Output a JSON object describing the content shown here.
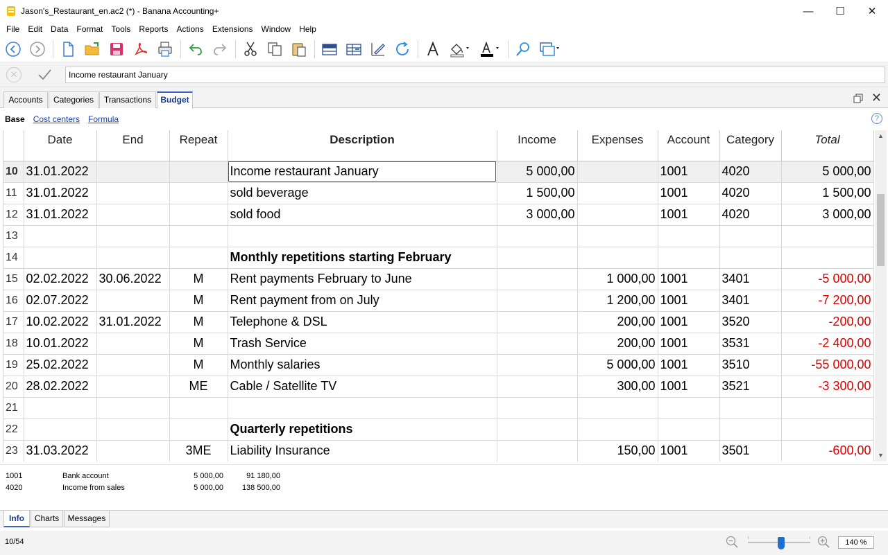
{
  "window": {
    "title": "Jason's_Restaurant_en.ac2 (*) - Banana Accounting+",
    "minimize": "—",
    "maximize": "☐",
    "close": "✕"
  },
  "menu": [
    "File",
    "Edit",
    "Data",
    "Format",
    "Tools",
    "Reports",
    "Actions",
    "Extensions",
    "Window",
    "Help"
  ],
  "toolbar_icons": [
    "back-icon",
    "forward-icon",
    "new-file-icon",
    "open-folder-icon",
    "save-icon",
    "pdf-icon",
    "print-icon",
    "undo-icon",
    "redo-icon",
    "cut-icon",
    "copy-icon",
    "paste-icon",
    "insert-rows-icon",
    "duplicate-row-icon",
    "edit-row-icon",
    "recalculate-icon",
    "font-icon",
    "fill-color-icon",
    "text-color-icon",
    "search-icon",
    "view-icon"
  ],
  "editline": {
    "value": "Income restaurant January"
  },
  "tabs": [
    "Accounts",
    "Categories",
    "Transactions",
    "Budget"
  ],
  "active_tab": "Budget",
  "views": {
    "base": "Base",
    "links": [
      "Cost centers",
      "Formula"
    ],
    "help": "?"
  },
  "table": {
    "columns": [
      "",
      "Date",
      "End",
      "Repeat",
      "Description",
      "Income",
      "Expenses",
      "Account",
      "Category",
      "Total"
    ],
    "rows": [
      {
        "n": "10",
        "date": "31.01.2022",
        "end": "",
        "repeat": "",
        "desc": "Income restaurant January",
        "income": "5 000,00",
        "expenses": "",
        "account": "1001",
        "category": "4020",
        "total": "5 000,00",
        "neg": false,
        "current": true
      },
      {
        "n": "11",
        "date": "31.01.2022",
        "end": "",
        "repeat": "",
        "desc": "sold beverage",
        "income": "1 500,00",
        "expenses": "",
        "account": "1001",
        "category": "4020",
        "total": "1 500,00",
        "neg": false
      },
      {
        "n": "12",
        "date": "31.01.2022",
        "end": "",
        "repeat": "",
        "desc": "sold food",
        "income": "3 000,00",
        "expenses": "",
        "account": "1001",
        "category": "4020",
        "total": "3 000,00",
        "neg": false
      },
      {
        "n": "13",
        "date": "",
        "end": "",
        "repeat": "",
        "desc": "",
        "income": "",
        "expenses": "",
        "account": "",
        "category": "",
        "total": "",
        "neg": false
      },
      {
        "n": "14",
        "date": "",
        "end": "",
        "repeat": "",
        "desc": "Monthly repetitions starting February",
        "income": "",
        "expenses": "",
        "account": "",
        "category": "",
        "total": "",
        "neg": false,
        "heading": true
      },
      {
        "n": "15",
        "date": "02.02.2022",
        "end": "30.06.2022",
        "repeat": "M",
        "desc": "Rent payments February to June",
        "income": "",
        "expenses": "1 000,00",
        "account": "1001",
        "category": "3401",
        "total": "-5 000,00",
        "neg": true
      },
      {
        "n": "16",
        "date": "02.07.2022",
        "end": "",
        "repeat": "M",
        "desc": "Rent payment from on July",
        "income": "",
        "expenses": "1 200,00",
        "account": "1001",
        "category": "3401",
        "total": "-7 200,00",
        "neg": true
      },
      {
        "n": "17",
        "date": "10.02.2022",
        "end": "31.01.2022",
        "repeat": "M",
        "desc": "Telephone & DSL",
        "income": "",
        "expenses": "200,00",
        "account": "1001",
        "category": "3520",
        "total": "-200,00",
        "neg": true
      },
      {
        "n": "18",
        "date": "10.01.2022",
        "end": "",
        "repeat": "M",
        "desc": "Trash Service",
        "income": "",
        "expenses": "200,00",
        "account": "1001",
        "category": "3531",
        "total": "-2 400,00",
        "neg": true
      },
      {
        "n": "19",
        "date": "25.02.2022",
        "end": "",
        "repeat": "M",
        "desc": "Monthly salaries",
        "income": "",
        "expenses": "5 000,00",
        "account": "1001",
        "category": "3510",
        "total": "-55 000,00",
        "neg": true
      },
      {
        "n": "20",
        "date": "28.02.2022",
        "end": "",
        "repeat": "ME",
        "desc": "Cable / Satellite TV",
        "income": "",
        "expenses": "300,00",
        "account": "1001",
        "category": "3521",
        "total": "-3 300,00",
        "neg": true
      },
      {
        "n": "21",
        "date": "",
        "end": "",
        "repeat": "",
        "desc": "",
        "income": "",
        "expenses": "",
        "account": "",
        "category": "",
        "total": "",
        "neg": false
      },
      {
        "n": "22",
        "date": "",
        "end": "",
        "repeat": "",
        "desc": "Quarterly repetitions",
        "income": "",
        "expenses": "",
        "account": "",
        "category": "",
        "total": "",
        "neg": false,
        "heading": true
      },
      {
        "n": "23",
        "date": "31.03.2022",
        "end": "",
        "repeat": "3ME",
        "desc": "Liability Insurance",
        "income": "",
        "expenses": "150,00",
        "account": "1001",
        "category": "3501",
        "total": "-600,00",
        "neg": true
      }
    ]
  },
  "info": {
    "rows": [
      {
        "account": "1001",
        "name": "Bank account",
        "v1": "5 000,00",
        "v2": "91 180,00"
      },
      {
        "account": "4020",
        "name": "Income from sales",
        "v1": "5 000,00",
        "v2": "138 500,00"
      }
    ]
  },
  "bottom_tabs": [
    "Info",
    "Charts",
    "Messages"
  ],
  "active_bottom_tab": "Info",
  "status": {
    "position": "10/54",
    "zoom": "140 %"
  },
  "colors": {
    "negative": "#e00000",
    "link": "#1a3fb0",
    "active_tab": "#1a3a8c",
    "slider_knob": "#1e6fd0"
  }
}
